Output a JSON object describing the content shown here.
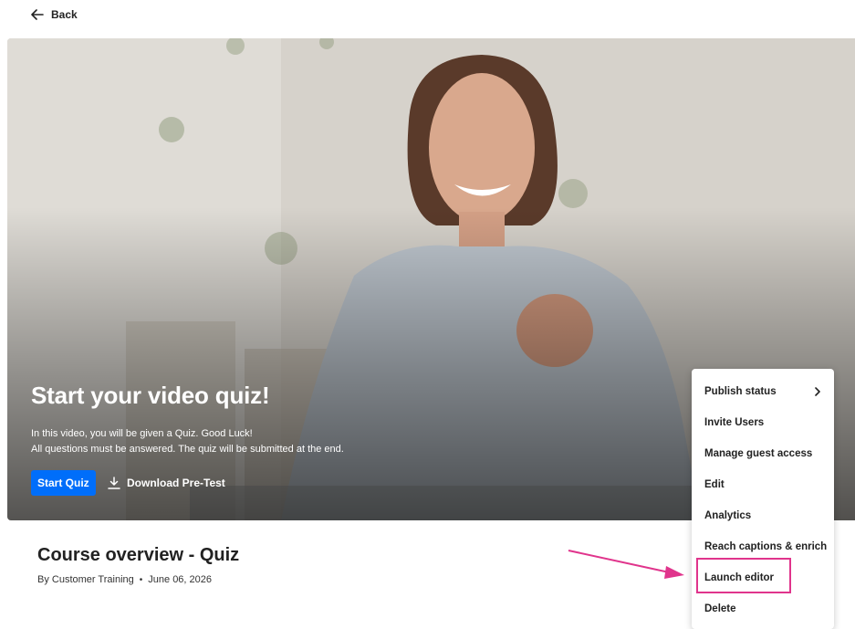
{
  "back": {
    "label": "Back",
    "icon": "arrow-left-icon"
  },
  "hero": {
    "title": "Start your video quiz!",
    "description_lines": [
      "In this video, you will be given a Quiz. Good Luck!",
      "All questions must be answered. The quiz will be submitted at the end."
    ],
    "start_button": "Start Quiz",
    "download_label": "Download Pre-Test",
    "download_icon": "download-icon"
  },
  "entry": {
    "title": "Course overview - Quiz",
    "author": "By Customer Training",
    "separator": "•",
    "date": "June 06, 2026"
  },
  "menu": {
    "items": [
      {
        "label": "Publish status",
        "icon": "chevron-right-icon"
      },
      {
        "label": "Invite Users"
      },
      {
        "label": "Manage guest access"
      },
      {
        "label": "Edit"
      },
      {
        "label": "Analytics"
      },
      {
        "label": "Reach captions & enrich"
      },
      {
        "label": "Launch editor"
      },
      {
        "label": "Delete"
      }
    ]
  },
  "colors": {
    "primary_button": "#006efa",
    "highlight": "#e0348c",
    "text": "#222222"
  }
}
